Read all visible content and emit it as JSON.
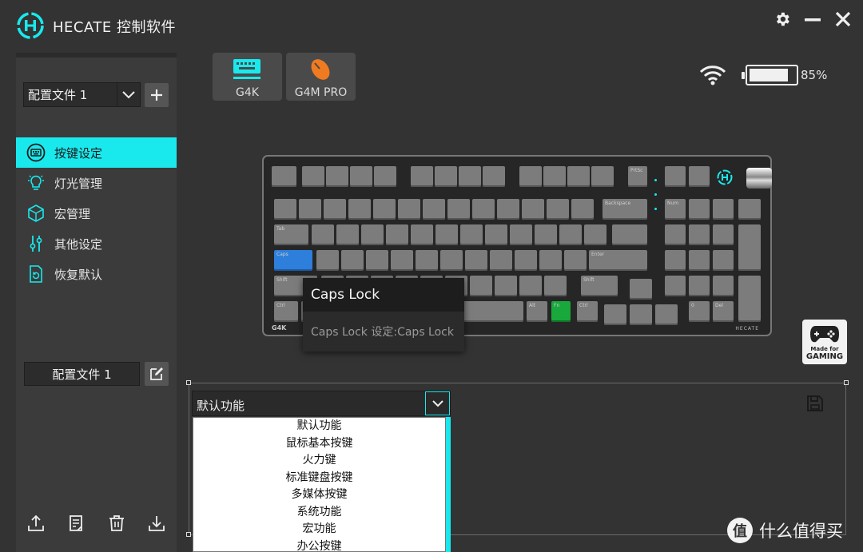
{
  "app": {
    "title": "HECATE 控制软件"
  },
  "window_controls": {
    "settings_icon": "gear-icon",
    "minimize_icon": "minimize-icon",
    "close_icon": "close-icon"
  },
  "sidebar": {
    "profile_select": "配置文件 1",
    "items": [
      {
        "label": "按键设定",
        "icon": "keyboard-icon",
        "active": true
      },
      {
        "label": "灯光管理",
        "icon": "bulb-icon",
        "active": false
      },
      {
        "label": "宏管理",
        "icon": "cube-icon",
        "active": false
      },
      {
        "label": "其他设定",
        "icon": "sliders-icon",
        "active": false
      },
      {
        "label": "恢复默认",
        "icon": "restore-icon",
        "active": false
      }
    ],
    "profile_name": "配置文件 1",
    "tools": [
      "export-icon",
      "notes-icon",
      "trash-icon",
      "download-icon"
    ]
  },
  "devices": [
    {
      "label": "G4K",
      "icon": "keyboard-icon"
    },
    {
      "label": "G4M PRO",
      "icon": "mouse-icon"
    }
  ],
  "status": {
    "battery_text": "85%",
    "battery_level": 0.85,
    "wifi_icon": "wifi-icon"
  },
  "keyboard": {
    "brand": "G4K",
    "maker": "HECATE",
    "legends": {
      "prtsc": "PrtSc",
      "backspace": "Backspace",
      "num": "Num",
      "tab": "Tab",
      "caps": "Caps",
      "enter": "Enter",
      "shift_l": "Shift",
      "shift_r": "Shift",
      "ctrl_l": "Ctrl",
      "alt_r": "Alt",
      "fn": "Fn",
      "ctrl_r": "Ctrl",
      "n0": "0",
      "del": "Del"
    },
    "colors": {
      "caps": "#2d7fdb",
      "fn": "#19a83c"
    }
  },
  "tooltip": {
    "title": "Caps Lock",
    "detail": "Caps Lock 设定:Caps Lock"
  },
  "badge": {
    "line1": "Made for",
    "line2": "GAMING"
  },
  "function_panel": {
    "selected": "默认功能",
    "options": [
      "默认功能",
      "鼠标基本按键",
      "火力键",
      "标准键盘按键",
      "多媒体按键",
      "系统功能",
      "宏功能",
      "办公按键"
    ]
  },
  "watermark": {
    "logo_text": "值",
    "text": "什么值得买"
  },
  "theme": {
    "accent": "#19e9ed",
    "background": "#333333",
    "sidebar": "#3b3b3b"
  }
}
